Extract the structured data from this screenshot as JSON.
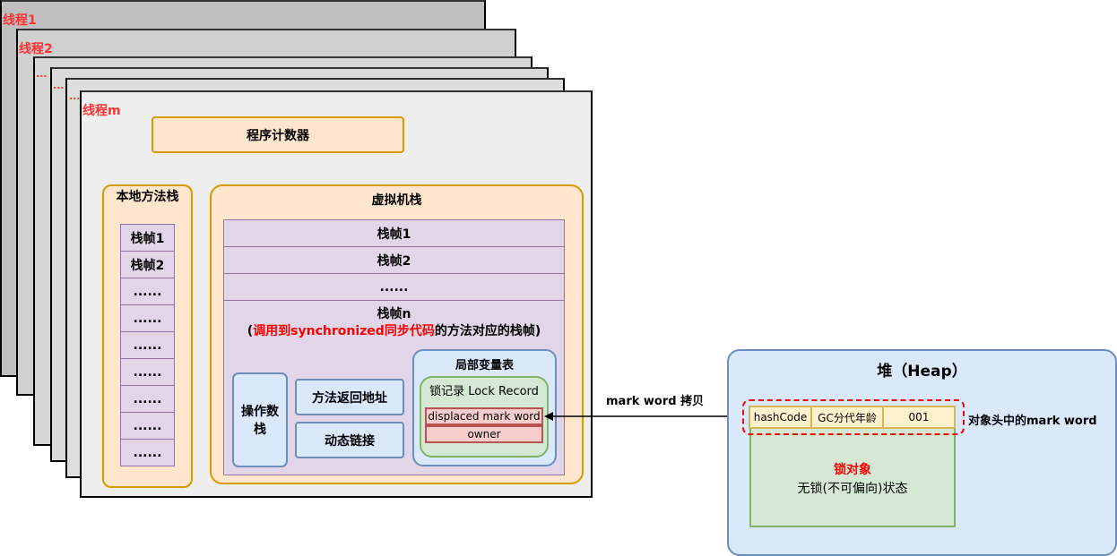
{
  "threads": {
    "t1": "线程1",
    "t2": "线程2",
    "dots1": "...",
    "dots2": "...",
    "dots3": "...",
    "tm": "线程m"
  },
  "pc": "程序计数器",
  "native_stack": {
    "title": "本地方法栈",
    "frames": [
      "栈帧1",
      "栈帧2",
      "......",
      "......",
      "......",
      "......",
      "......",
      "......",
      "......"
    ]
  },
  "vm_stack": {
    "title": "虚拟机栈",
    "frames": [
      "栈帧1",
      "栈帧2",
      "......"
    ],
    "frame_n": {
      "title": "栈帧n",
      "paren_open": "(",
      "highlight": "调用到synchronized同步代码",
      "rest": "的方法对应的栈帧)",
      "operand_stack": "操作数栈",
      "return_address": "方法返回地址",
      "dynamic_link": "动态链接",
      "local_vars": {
        "title": "局部变量表",
        "lock_record": {
          "title": "锁记录 Lock Record",
          "displaced": "displaced mark word",
          "owner": "owner"
        }
      }
    }
  },
  "arrow_label": "mark word 拷贝",
  "heap": {
    "title": "堆（Heap）",
    "mark_word": [
      "hashCode",
      "GC分代年龄",
      "001"
    ],
    "mark_word_label": "对象头中的mark word",
    "object_title": "锁对象",
    "object_state": "无锁(不可偏向)状态"
  },
  "colors": {
    "red": "#ff0000",
    "orange": "#d79b00",
    "purple": "#9673a6",
    "blue": "#6c8ebf",
    "green": "#82b366"
  }
}
